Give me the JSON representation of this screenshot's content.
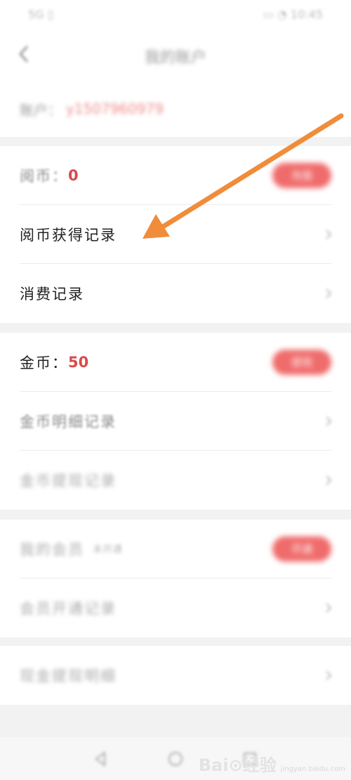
{
  "status_bar": {
    "left": "5G  ▯",
    "right": "▭ ◔ 10:45"
  },
  "header": {
    "title": "我的账户",
    "back_icon": "chevron-left-icon"
  },
  "account": {
    "label": "账户：",
    "value": "y1507960979"
  },
  "yuebi_section": {
    "label": "阅币：",
    "amount": "0",
    "action_label": "充值",
    "items": [
      {
        "label": "阅币获得记录"
      },
      {
        "label": "消费记录"
      }
    ]
  },
  "jinbi_section": {
    "label": "金币：",
    "amount": "50",
    "action_label": "提现",
    "items": [
      {
        "label": "金币明细记录"
      },
      {
        "label": "金币提现记录"
      }
    ]
  },
  "vip_section": {
    "label": "我的会员",
    "note": "未开通",
    "action_label": "开通",
    "items": [
      {
        "label": "会员开通记录"
      }
    ]
  },
  "extra_section": {
    "items": [
      {
        "label": "现金提现明细"
      }
    ]
  },
  "nav_bar": {
    "back": "nav-back-icon",
    "home": "nav-home-icon",
    "recent": "nav-recent-icon"
  },
  "watermark": {
    "main": "Bai⊙经验",
    "sub": "jingyan.baidu.com"
  },
  "colors": {
    "accent_red": "#d84a4a",
    "pill_red": "#f06b6b",
    "arrow_orange": "#f08c3a"
  }
}
